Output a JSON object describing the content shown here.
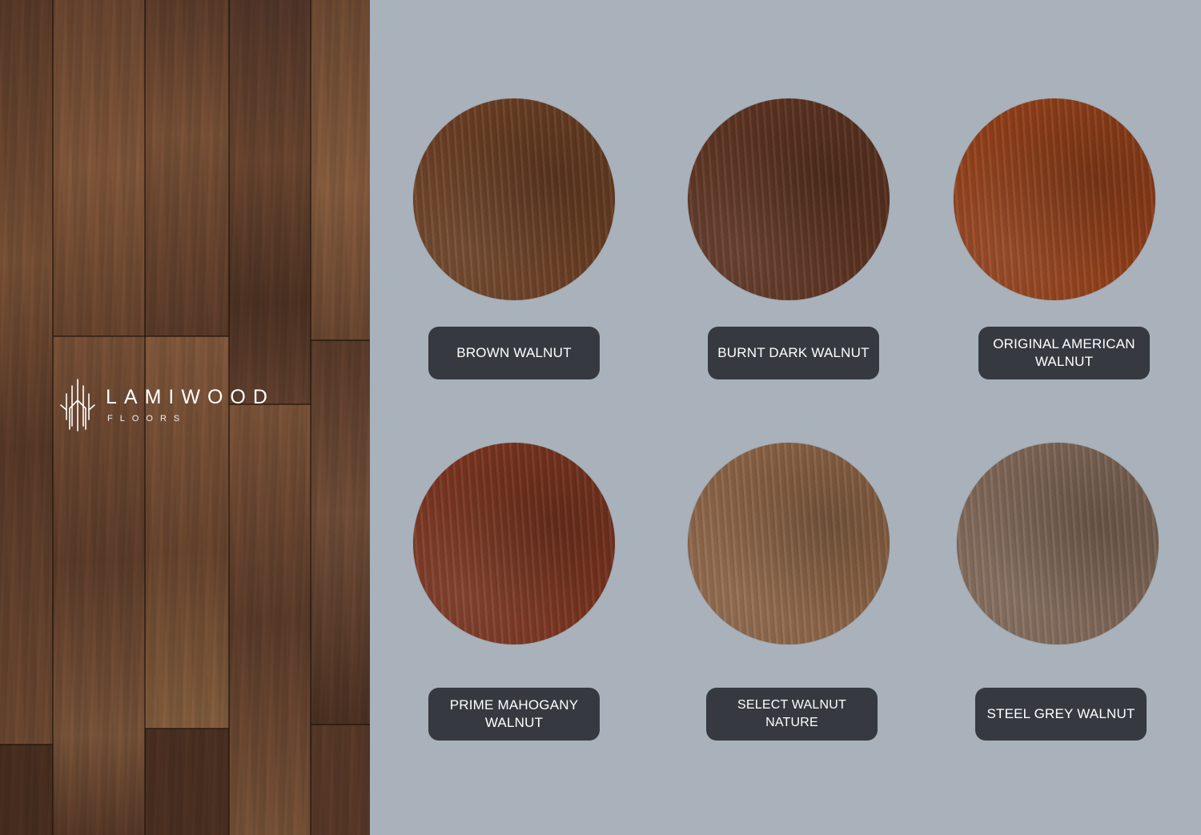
{
  "brand": {
    "name": "LAMIWOOD",
    "tagline": "FLOORS",
    "logo_icon": "lamiwood-tree-icon"
  },
  "colors": {
    "background": "#a9b2bb",
    "label_background": "#363a40",
    "label_text": "#ffffff",
    "wood_panel": "#6a4a36"
  },
  "swatches": [
    {
      "label": "BROWN WALNUT",
      "color": "#6b3f24"
    },
    {
      "label": "BURNT DARK WALNUT",
      "color": "#5e3422"
    },
    {
      "label": "ORIGINAL AMERICAN\nWALNUT",
      "color": "#92401a"
    },
    {
      "label": "PRIME MAHOGANY\nWALNUT",
      "color": "#7a3520"
    },
    {
      "label": "SELECT WALNUT NATURE",
      "color": "#8c6446"
    },
    {
      "label": "STEEL GREY WALNUT",
      "color": "#7f6757"
    }
  ]
}
